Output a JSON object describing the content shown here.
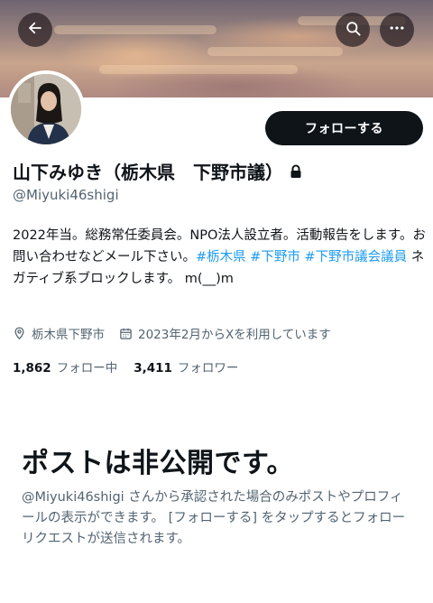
{
  "header": {
    "back_icon": "arrow-left-icon",
    "search_icon": "search-icon",
    "more_icon": "more-horizontal-icon"
  },
  "profile": {
    "display_name": "山下みゆき（栃木県　下野市議）",
    "handle": "@Miyuki46shigi",
    "protected_icon": "lock-icon",
    "follow_button_label": "フォローする",
    "bio": {
      "text_1": "2022年当。総務常任委員会。NPO法人設立者。活動報告をします。お問い合わせなどメール下さい。",
      "hashtag_1": "#栃木県",
      "hashtag_2": "#下野市",
      "hashtag_3": "#下野市議会議員",
      "text_2": " ネガティブ系ブロックします。 m(__)m"
    },
    "location": "栃木県下野市",
    "joined": "2023年2月からXを利用しています",
    "following_count": "1,862",
    "following_label": "フォロー中",
    "followers_count": "3,411",
    "followers_label": "フォロワー"
  },
  "private_notice": {
    "title": "ポストは非公開です。",
    "description": "@Miyuki46shigi さんから承認された場合のみポストやプロフィールの表示ができます。 [フォローする] をタップするとフォローリクエストが送信されます。"
  },
  "colors": {
    "text_primary": "#0f1419",
    "text_secondary": "#536471",
    "link": "#1d9bf0",
    "button_bg": "#0f1419"
  }
}
